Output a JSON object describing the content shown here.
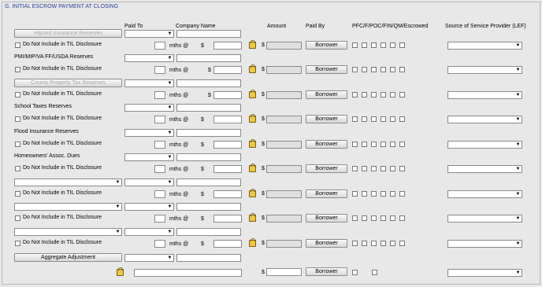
{
  "section": {
    "title": "G. INITIAL ESCROW PAYMENT AT CLOSING"
  },
  "headers": {
    "paid_to": "Paid To",
    "company_name": "Company Name",
    "amount": "Amount",
    "paid_by": "Paid By",
    "flags": "PFC/F/POC/FIN/QM/Escrowed",
    "source": "Source of Service Provider (LEF)"
  },
  "labels": {
    "do_not_include": "Do Not Include in TIL Disclosure",
    "mths_at": "mths @",
    "dollar": "$",
    "borrower": "Borrower"
  },
  "rows": [
    {
      "label": "Hazard Insurance Reserves",
      "label_kind": "button-disabled"
    },
    {
      "label": "PMI/MIP/VA FF/USDA Reserves",
      "label_kind": "text"
    },
    {
      "label": "County Property Tax Reserves",
      "label_kind": "button-disabled"
    },
    {
      "label": "School Taxes Reserves",
      "label_kind": "text"
    },
    {
      "label": "Flood Insurance Reserves",
      "label_kind": "text"
    },
    {
      "label": "Homeowners' Assoc. Dues",
      "label_kind": "text"
    },
    {
      "label": "",
      "label_kind": "select"
    },
    {
      "label": "",
      "label_kind": "select"
    },
    {
      "label": "",
      "label_kind": "select"
    }
  ],
  "aggregate": {
    "label": "Aggregate Adjustment"
  }
}
